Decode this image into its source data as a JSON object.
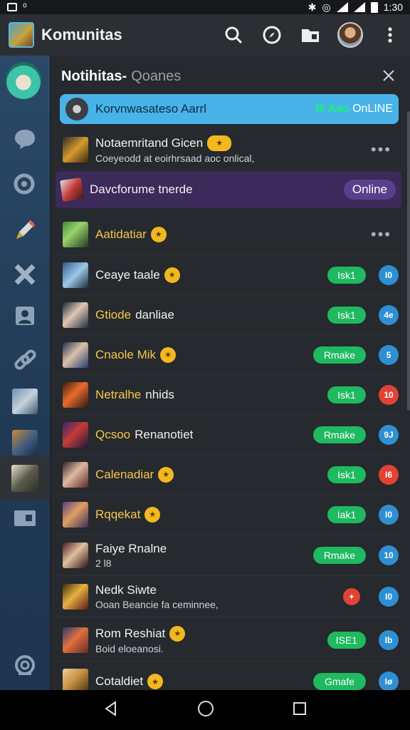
{
  "status_bar": {
    "left_text": "⁰",
    "time": "1:30"
  },
  "app": {
    "title": "Komunitas",
    "accent": "#47b3e8"
  },
  "panel": {
    "title": "Notihitas-",
    "subtitle": "Qoanes"
  },
  "banner": {
    "name": "Korvnwasateso Aarrl",
    "status_green": "I6 Aao",
    "status_white": "OnLINE"
  },
  "rows": [
    {
      "name": "Notaemritand Gicen",
      "highlight": "",
      "badge": "★",
      "desc": "Coeyeodd at eoirhrsaad aoc onlical,",
      "action": "more"
    },
    {
      "name": "Davcforume tnerde",
      "highlight": "",
      "badge": "",
      "desc": "",
      "action": "online",
      "action_label": "Online"
    },
    {
      "name": "",
      "highlight": "Aatidatiar",
      "badge": "★",
      "desc": "",
      "action": "more"
    },
    {
      "name": "Ceaye taale",
      "highlight": "",
      "badge": "★",
      "desc": "",
      "pill": "Isk1",
      "count": "I0",
      "count_color": "blue"
    },
    {
      "name": "danliae",
      "highlight": "Gtiode",
      "badge": "",
      "desc": "",
      "pill": "Isk1",
      "count": "4e",
      "count_color": "blue"
    },
    {
      "name": "",
      "highlight": "Cnaole Mik",
      "badge": "★",
      "desc": "",
      "pill": "Rmake",
      "count": "5",
      "count_color": "blue"
    },
    {
      "name": "nhids",
      "highlight": "Netralhe",
      "badge": "",
      "desc": "",
      "pill": "Isk1",
      "count": "10",
      "count_color": "red"
    },
    {
      "name": "Renanotiet",
      "highlight": "Qcsoo",
      "badge": "",
      "desc": "",
      "pill": "Rmake",
      "count": "9J",
      "count_color": "blue"
    },
    {
      "name": "",
      "highlight": "Calenadiar",
      "badge": "★",
      "desc": "",
      "pill": "Isk1",
      "count": "I6",
      "count_color": "red"
    },
    {
      "name": "",
      "highlight": "Rqqekat",
      "badge": "★",
      "desc": "",
      "pill": "Iak1",
      "count": "I0",
      "count_color": "blue"
    },
    {
      "name": "Faiye Rnalne",
      "highlight": "",
      "badge": "",
      "desc": "2 l8",
      "pill": "Rmake",
      "count": "10",
      "count_color": "blue"
    },
    {
      "name": "Nedk Siwte",
      "highlight": "",
      "badge": "",
      "desc": "Ooan Beancie fa ceminnee,",
      "pill": "",
      "flag": "+",
      "count": "I0",
      "count_color": "blue"
    },
    {
      "name": "Rom Reshiat",
      "highlight": "",
      "badge": "★",
      "desc": "Boid eloeanosi.",
      "pill": "ISE1",
      "count": "Ib",
      "count_color": "blue"
    },
    {
      "name": "Cotaldiet",
      "highlight": "",
      "badge": "★",
      "desc": "",
      "pill": "Gmafe",
      "count": "Iø",
      "count_color": "blue"
    }
  ],
  "sidebar_icons": [
    "chat-icon",
    "search-icon",
    "pencil-icon",
    "cross-icon",
    "contact-icon",
    "link-icon",
    "game-icon",
    "game-icon",
    "game-icon",
    "folder-icon",
    "settings-icon"
  ]
}
